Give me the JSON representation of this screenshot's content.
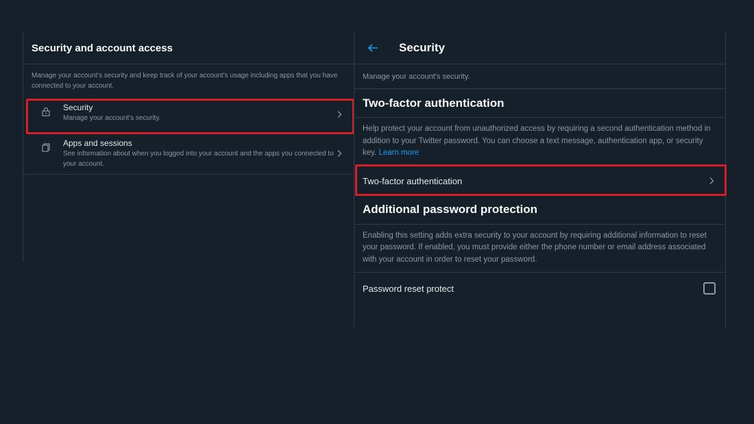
{
  "left": {
    "title": "Security and account access",
    "description": "Manage your account's security and keep track of your account's usage including apps that you have connected to your account.",
    "items": [
      {
        "title": "Security",
        "subtitle": "Manage your account's security.",
        "icon": "lock-icon"
      },
      {
        "title": "Apps and sessions",
        "subtitle": "See information about when you logged into your account and the apps you connected to your account.",
        "icon": "copy-icon"
      }
    ]
  },
  "right": {
    "title": "Security",
    "description": "Manage your account's security.",
    "two_factor": {
      "heading": "Two-factor authentication",
      "body": "Help protect your account from unauthorized access by requiring a second authentication method in addition to your Twitter password. You can choose a text message, authentication app, or security key. ",
      "link": "Learn more",
      "row_label": "Two-factor authentication"
    },
    "password_protection": {
      "heading": "Additional password protection",
      "body": "Enabling this setting adds extra security to your account by requiring additional information to reset your password. If enabled, you must provide either the phone number or email address associated with your account in order to reset your password.",
      "checkbox_label": "Password reset protect",
      "checked": false
    }
  },
  "colors": {
    "background": "#15202b",
    "accent": "#1d9bf0",
    "highlight": "#d61f26"
  }
}
